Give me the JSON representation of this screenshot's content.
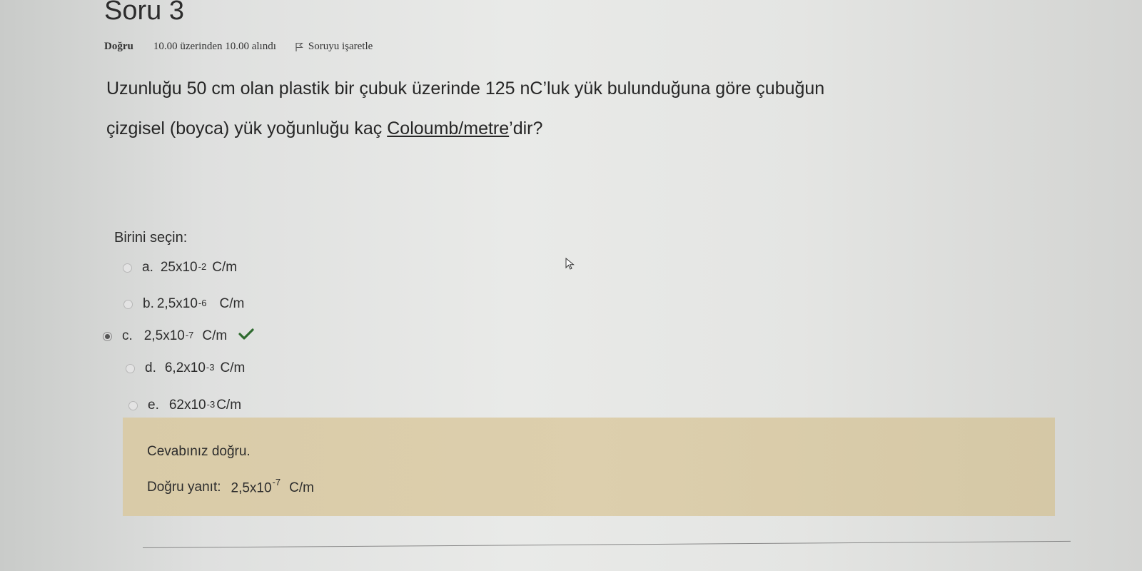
{
  "question": {
    "number": "Soru 3",
    "state": "Doğru",
    "grade": "10.00 üzerinden 10.00 alındı",
    "flag_label": "Soruyu işaretle",
    "text_line1": "Uzunluğu 50 cm olan plastik bir çubuk üzerinde 125 nC’luk yük bulunduğuna göre çubuğun",
    "text_line2_prefix": "çizgisel (boyca) yük yoğunluğu kaç ",
    "text_line2_underlined": "Coloumb/metre",
    "text_line2_suffix": "’dir?"
  },
  "prompt": "Birini seçin:",
  "options": [
    {
      "letter": "a.",
      "base": "25x10",
      "exponent": "-2",
      "unit": "C/m",
      "selected": false
    },
    {
      "letter": "b.",
      "base": "2,5x10",
      "exponent": "-6",
      "unit": "C/m",
      "selected": false
    },
    {
      "letter": "c.",
      "base": "2,5x10",
      "exponent": "-7",
      "unit": "C/m",
      "selected": true
    },
    {
      "letter": "d.",
      "base": "6,2x10",
      "exponent": "-3",
      "unit": "C/m",
      "selected": false
    },
    {
      "letter": "e.",
      "base": "62x10",
      "exponent": "-3",
      "unit": "C/m",
      "selected": false
    }
  ],
  "feedback": {
    "correct_text": "Cevabınız doğru.",
    "right_answer_label": "Doğru yanıt:",
    "right_answer_base": "2,5x10",
    "right_answer_exponent": "-7",
    "right_answer_unit": "C/m"
  },
  "colors": {
    "feedback_bg": "#ddcfad",
    "check": "#2f6b2f"
  },
  "icons": {
    "flag": "flag-icon",
    "check": "check-icon",
    "cursor": "mouse-pointer-icon"
  }
}
